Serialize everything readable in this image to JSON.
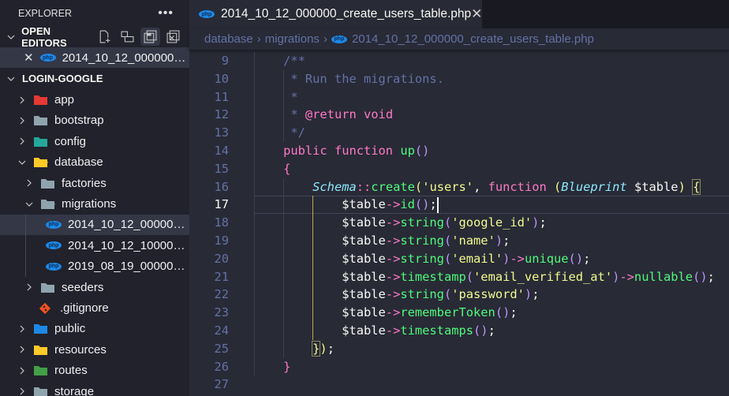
{
  "sidebar": {
    "title": "EXPLORER",
    "more_icon": "ellipsis-icon",
    "open_editors": {
      "label": "OPEN EDITORS",
      "files": [
        {
          "name": "2014_10_12_000000_c...",
          "icon": "php-icon"
        }
      ]
    },
    "project": {
      "label": "LOGIN-GOOGLE"
    },
    "tree": [
      {
        "label": "app",
        "depth": 0,
        "type": "folder",
        "expanded": false,
        "color": "#e53935"
      },
      {
        "label": "bootstrap",
        "depth": 0,
        "type": "folder",
        "expanded": false,
        "color": "#90a4ae"
      },
      {
        "label": "config",
        "depth": 0,
        "type": "folder",
        "expanded": false,
        "color": "#26a69a"
      },
      {
        "label": "database",
        "depth": 0,
        "type": "folder",
        "expanded": true,
        "color": "#ffca28"
      },
      {
        "label": "factories",
        "depth": 1,
        "type": "folder",
        "expanded": false,
        "color": "#90a4ae"
      },
      {
        "label": "migrations",
        "depth": 1,
        "type": "folder",
        "expanded": true,
        "color": "#90a4ae"
      },
      {
        "label": "2014_10_12_000000...",
        "depth": 2,
        "type": "php",
        "selected": true
      },
      {
        "label": "2014_10_12_100000...",
        "depth": 2,
        "type": "php"
      },
      {
        "label": "2019_08_19_000000...",
        "depth": 2,
        "type": "php"
      },
      {
        "label": "seeders",
        "depth": 1,
        "type": "folder",
        "expanded": false,
        "color": "#90a4ae"
      },
      {
        "label": ".gitignore",
        "depth": 1,
        "type": "git",
        "color": "#f4511e"
      },
      {
        "label": "public",
        "depth": 0,
        "type": "folder",
        "expanded": false,
        "color": "#1e88e5"
      },
      {
        "label": "resources",
        "depth": 0,
        "type": "folder",
        "expanded": false,
        "color": "#ffca28"
      },
      {
        "label": "routes",
        "depth": 0,
        "type": "folder",
        "expanded": false,
        "color": "#43a047"
      },
      {
        "label": "storage",
        "depth": 0,
        "type": "folder",
        "expanded": false,
        "color": "#90a4ae"
      }
    ]
  },
  "tab": {
    "label": "2014_10_12_000000_create_users_table.php",
    "icon": "php-icon",
    "php_badge": "php"
  },
  "breadcrumb": [
    "database",
    "migrations",
    "2014_10_12_000000_create_users_table.php"
  ],
  "editor": {
    "current_line": 17,
    "lines": [
      {
        "n": "9",
        "tokens": [
          [
            "    ",
            "pl"
          ],
          [
            "/**",
            "cmt"
          ]
        ]
      },
      {
        "n": "10",
        "tokens": [
          [
            "     * Run the migrations.",
            "cmt"
          ]
        ]
      },
      {
        "n": "11",
        "tokens": [
          [
            "     *",
            "cmt"
          ]
        ]
      },
      {
        "n": "12",
        "tokens": [
          [
            "     * ",
            "cmt"
          ],
          [
            "@return",
            "tag"
          ],
          [
            " void",
            "kw"
          ]
        ]
      },
      {
        "n": "13",
        "tokens": [
          [
            "     */",
            "cmt"
          ]
        ]
      },
      {
        "n": "14",
        "tokens": [
          [
            "    ",
            "pl"
          ],
          [
            "public function ",
            "kw"
          ],
          [
            "up",
            "fn"
          ],
          [
            "()",
            "b3"
          ]
        ]
      },
      {
        "n": "15",
        "tokens": [
          [
            "    ",
            "pl"
          ],
          [
            "{",
            "b1"
          ]
        ]
      },
      {
        "n": "16",
        "tokens": [
          [
            "        ",
            "pl"
          ],
          [
            "Schema",
            "cls"
          ],
          [
            "::",
            "op"
          ],
          [
            "create",
            "fn"
          ],
          [
            "(",
            "b2"
          ],
          [
            "'users'",
            "str"
          ],
          [
            ", ",
            "pl"
          ],
          [
            "function ",
            "kw"
          ],
          [
            "(",
            "b2"
          ],
          [
            "Blueprint",
            "cls"
          ],
          [
            " $table",
            "var"
          ],
          [
            ")",
            "b2"
          ],
          [
            " ",
            "pl"
          ],
          [
            "{",
            "b2 bm"
          ]
        ]
      },
      {
        "n": "17",
        "tokens": [
          [
            "            $table",
            "var"
          ],
          [
            "->",
            "op"
          ],
          [
            "id",
            "fn"
          ],
          [
            "()",
            "b3"
          ],
          [
            ";",
            "pl"
          ]
        ]
      },
      {
        "n": "18",
        "tokens": [
          [
            "            $table",
            "var"
          ],
          [
            "->",
            "op"
          ],
          [
            "string",
            "fn"
          ],
          [
            "(",
            "b3"
          ],
          [
            "'google_id'",
            "str"
          ],
          [
            ")",
            "b3"
          ],
          [
            ";",
            "pl"
          ]
        ]
      },
      {
        "n": "19",
        "tokens": [
          [
            "            $table",
            "var"
          ],
          [
            "->",
            "op"
          ],
          [
            "string",
            "fn"
          ],
          [
            "(",
            "b3"
          ],
          [
            "'name'",
            "str"
          ],
          [
            ")",
            "b3"
          ],
          [
            ";",
            "pl"
          ]
        ]
      },
      {
        "n": "20",
        "tokens": [
          [
            "            $table",
            "var"
          ],
          [
            "->",
            "op"
          ],
          [
            "string",
            "fn"
          ],
          [
            "(",
            "b3"
          ],
          [
            "'email'",
            "str"
          ],
          [
            ")",
            "b3"
          ],
          [
            "->",
            "op"
          ],
          [
            "unique",
            "fn"
          ],
          [
            "()",
            "b3"
          ],
          [
            ";",
            "pl"
          ]
        ]
      },
      {
        "n": "21",
        "tokens": [
          [
            "            $table",
            "var"
          ],
          [
            "->",
            "op"
          ],
          [
            "timestamp",
            "fn"
          ],
          [
            "(",
            "b3"
          ],
          [
            "'email_verified_at'",
            "str"
          ],
          [
            ")",
            "b3"
          ],
          [
            "->",
            "op"
          ],
          [
            "nullable",
            "fn"
          ],
          [
            "()",
            "b3"
          ],
          [
            ";",
            "pl"
          ]
        ]
      },
      {
        "n": "22",
        "tokens": [
          [
            "            $table",
            "var"
          ],
          [
            "->",
            "op"
          ],
          [
            "string",
            "fn"
          ],
          [
            "(",
            "b3"
          ],
          [
            "'password'",
            "str"
          ],
          [
            ")",
            "b3"
          ],
          [
            ";",
            "pl"
          ]
        ]
      },
      {
        "n": "23",
        "tokens": [
          [
            "            $table",
            "var"
          ],
          [
            "->",
            "op"
          ],
          [
            "rememberToken",
            "fn"
          ],
          [
            "()",
            "b3"
          ],
          [
            ";",
            "pl"
          ]
        ]
      },
      {
        "n": "24",
        "tokens": [
          [
            "            $table",
            "var"
          ],
          [
            "->",
            "op"
          ],
          [
            "timestamps",
            "fn"
          ],
          [
            "()",
            "b3"
          ],
          [
            ";",
            "pl"
          ]
        ]
      },
      {
        "n": "25",
        "tokens": [
          [
            "        ",
            "pl"
          ],
          [
            "}",
            "b2 bm"
          ],
          [
            ")",
            "b2"
          ],
          [
            ";",
            "pl"
          ]
        ]
      },
      {
        "n": "26",
        "tokens": [
          [
            "    ",
            "pl"
          ],
          [
            "}",
            "b1"
          ]
        ]
      },
      {
        "n": "27",
        "tokens": []
      }
    ]
  },
  "colors": {
    "editor_bg": "#282a36",
    "sidebar_bg": "#21222c",
    "tabbar_bg": "#191a21",
    "comment": "#6272a4",
    "keyword": "#ff79c6",
    "function": "#50fa7b",
    "string": "#f1fa8c",
    "class": "#8be9fd"
  }
}
